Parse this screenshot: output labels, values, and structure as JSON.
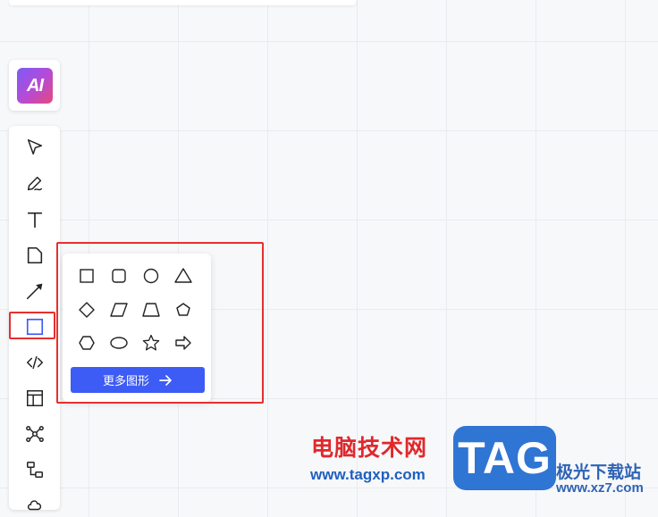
{
  "ai_button": {
    "label": "AI"
  },
  "toolbar": {
    "tools": [
      "select-tool",
      "pen-tool",
      "text-tool",
      "sticky-note-tool",
      "arrow-tool",
      "shape-tool",
      "code-tool",
      "layout-tool",
      "mindmap-tool",
      "flowchart-tool",
      "more-shapes-tool"
    ]
  },
  "shape_panel": {
    "shapes": [
      "square",
      "rounded-square",
      "circle",
      "triangle",
      "diamond",
      "parallelogram",
      "trapezoid",
      "pentagon",
      "hexagon",
      "ellipse",
      "star",
      "arrow"
    ],
    "more_label": "更多图形"
  },
  "watermark": {
    "cn": "电脑技术网",
    "url": "www.tagxp.com",
    "tag": "TAG",
    "site": "极光下载站",
    "site_url": "www.xz7.com"
  },
  "colors": {
    "accent": "#3d5bf5",
    "highlight": "#e62f2f"
  }
}
